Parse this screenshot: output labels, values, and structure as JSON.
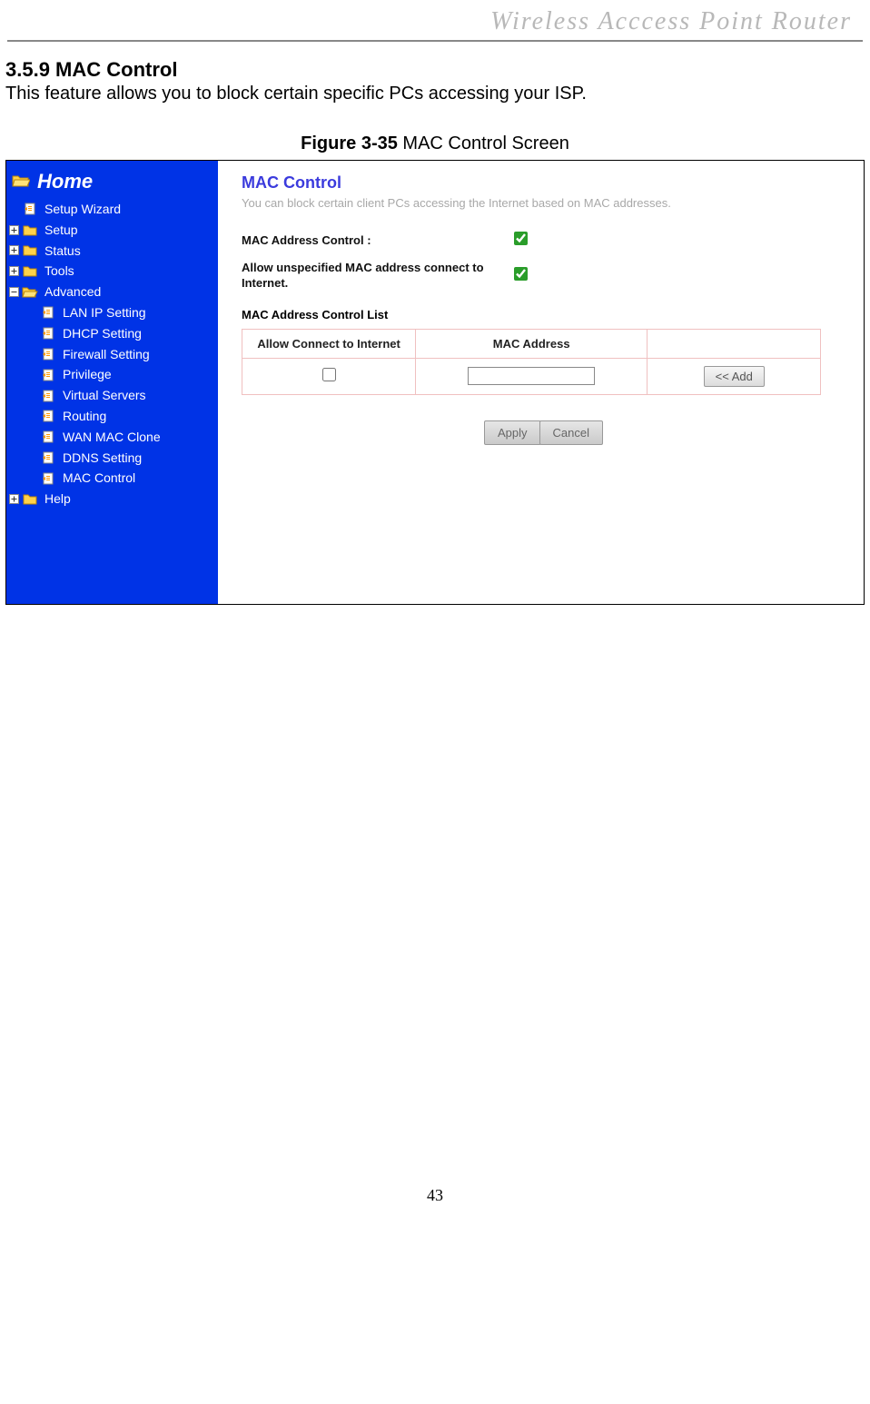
{
  "page_header": "Wireless  Acccess  Point  Router",
  "section": {
    "heading": "3.5.9 MAC Control",
    "description": "This feature allows you to block certain specific PCs accessing your ISP."
  },
  "figure": {
    "label_bold": "Figure 3-35",
    "label_rest": " MAC Control Screen"
  },
  "sidebar": {
    "home": "Home",
    "items": [
      {
        "label": "Setup Wizard",
        "toggle": "",
        "icon": "page",
        "indent": 0
      },
      {
        "label": "Setup",
        "toggle": "+",
        "icon": "folder",
        "indent": 0
      },
      {
        "label": "Status",
        "toggle": "+",
        "icon": "folder",
        "indent": 0
      },
      {
        "label": "Tools",
        "toggle": "+",
        "icon": "folder",
        "indent": 0
      },
      {
        "label": "Advanced",
        "toggle": "-",
        "icon": "folder-open",
        "indent": 0
      },
      {
        "label": "LAN IP Setting",
        "toggle": "",
        "icon": "page",
        "indent": 1
      },
      {
        "label": "DHCP Setting",
        "toggle": "",
        "icon": "page",
        "indent": 1
      },
      {
        "label": "Firewall Setting",
        "toggle": "",
        "icon": "page",
        "indent": 1
      },
      {
        "label": "Privilege",
        "toggle": "",
        "icon": "page",
        "indent": 1
      },
      {
        "label": "Virtual Servers",
        "toggle": "",
        "icon": "page",
        "indent": 1
      },
      {
        "label": "Routing",
        "toggle": "",
        "icon": "page",
        "indent": 1
      },
      {
        "label": "WAN MAC Clone",
        "toggle": "",
        "icon": "page",
        "indent": 1
      },
      {
        "label": "DDNS Setting",
        "toggle": "",
        "icon": "page",
        "indent": 1
      },
      {
        "label": "MAC Control",
        "toggle": "",
        "icon": "page",
        "indent": 1
      },
      {
        "label": "Help",
        "toggle": "+",
        "icon": "folder",
        "indent": 0
      }
    ]
  },
  "content": {
    "title": "MAC Control",
    "subdesc": "You can block certain client PCs accessing the Internet based on MAC addresses.",
    "mac_address_control_label": "MAC Address Control :",
    "mac_address_control_checked": true,
    "allow_unspecified_label": "Allow unspecified MAC address connect to Internet.",
    "allow_unspecified_checked": true,
    "list_heading": "MAC Address Control List",
    "table": {
      "col1": "Allow Connect to Internet",
      "col2": "MAC Address",
      "col3": "",
      "row": {
        "allow_checked": false,
        "mac_value": "",
        "add_label": "<< Add"
      }
    },
    "apply_label": "Apply",
    "cancel_label": "Cancel"
  },
  "page_number": "43"
}
